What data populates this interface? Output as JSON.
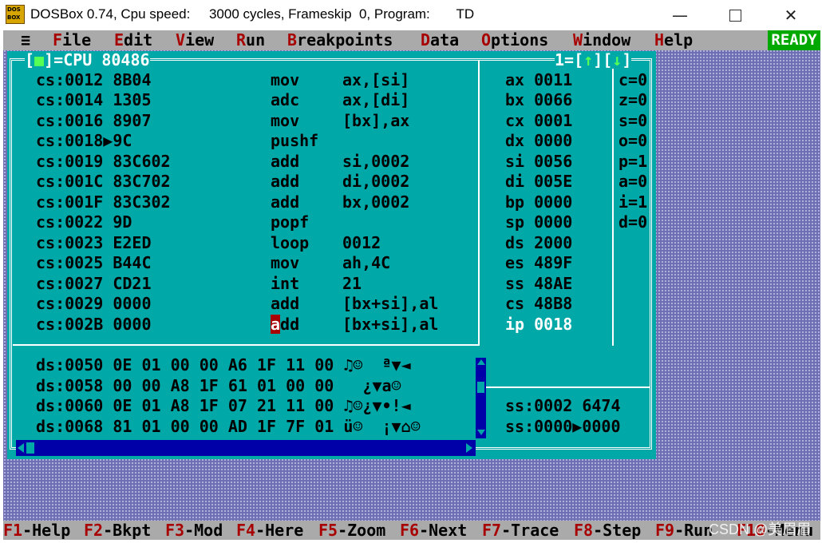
{
  "window": {
    "title": "DOSBox 0.74, Cpu speed:     3000 cycles, Frameskip  0, Program:       TD",
    "minimize": "—",
    "close": "✕"
  },
  "menu": {
    "system": "≡",
    "items": [
      {
        "hk": "F",
        "rest": "ile"
      },
      {
        "hk": "E",
        "rest": "dit"
      },
      {
        "hk": "V",
        "rest": "iew"
      },
      {
        "hk": "R",
        "rest": "un"
      },
      {
        "hk": "B",
        "rest": "reakpoints"
      },
      {
        "hk": "D",
        "rest": "ata"
      },
      {
        "hk": "O",
        "rest": "ptions"
      },
      {
        "hk": "W",
        "rest": "indow"
      },
      {
        "hk": "H",
        "rest": "elp"
      }
    ],
    "status": "READY"
  },
  "cpu": {
    "title": "CPU 80486",
    "window_number": "1",
    "close_box": "[■]",
    "scroll_up": "[↑]",
    "scroll_down": "[↓]",
    "code": [
      {
        "addr": "cs:0012",
        "mark": " ",
        "bytes": "8B04",
        "mnemonic": "mov",
        "operands": "ax,[si]"
      },
      {
        "addr": "cs:0014",
        "mark": " ",
        "bytes": "1305",
        "mnemonic": "adc",
        "operands": "ax,[di]"
      },
      {
        "addr": "cs:0016",
        "mark": " ",
        "bytes": "8907",
        "mnemonic": "mov",
        "operands": "[bx],ax"
      },
      {
        "addr": "cs:0018",
        "mark": "▶",
        "bytes": "9C",
        "mnemonic": "pushf",
        "operands": ""
      },
      {
        "addr": "cs:0019",
        "mark": " ",
        "bytes": "83C602",
        "mnemonic": "add",
        "operands": "si,0002"
      },
      {
        "addr": "cs:001C",
        "mark": " ",
        "bytes": "83C702",
        "mnemonic": "add",
        "operands": "di,0002"
      },
      {
        "addr": "cs:001F",
        "mark": " ",
        "bytes": "83C302",
        "mnemonic": "add",
        "operands": "bx,0002"
      },
      {
        "addr": "cs:0022",
        "mark": " ",
        "bytes": "9D",
        "mnemonic": "popf",
        "operands": ""
      },
      {
        "addr": "cs:0023",
        "mark": " ",
        "bytes": "E2ED",
        "mnemonic": "loop",
        "operands": "0012"
      },
      {
        "addr": "cs:0025",
        "mark": " ",
        "bytes": "B44C",
        "mnemonic": "mov",
        "operands": "ah,4C"
      },
      {
        "addr": "cs:0027",
        "mark": " ",
        "bytes": "CD21",
        "mnemonic": "int",
        "operands": "21"
      },
      {
        "addr": "cs:0029",
        "mark": " ",
        "bytes": "0000",
        "mnemonic": "add",
        "operands": "[bx+si],al"
      },
      {
        "addr": "cs:002B",
        "mark": " ",
        "bytes": "0000",
        "mnemonic": "add",
        "operands": "[bx+si],al"
      }
    ],
    "cursor_char": "a",
    "cursor_rest": "dd",
    "registers": [
      {
        "name": "ax",
        "value": "0011"
      },
      {
        "name": "bx",
        "value": "0066"
      },
      {
        "name": "cx",
        "value": "0001"
      },
      {
        "name": "dx",
        "value": "0000"
      },
      {
        "name": "si",
        "value": "0056"
      },
      {
        "name": "di",
        "value": "005E"
      },
      {
        "name": "bp",
        "value": "0000"
      },
      {
        "name": "sp",
        "value": "0000"
      },
      {
        "name": "ds",
        "value": "2000"
      },
      {
        "name": "es",
        "value": "489F"
      },
      {
        "name": "ss",
        "value": "48AE"
      },
      {
        "name": "cs",
        "value": "48B8"
      },
      {
        "name": "ip",
        "value": "0018"
      }
    ],
    "flags": [
      "c=0",
      "z=0",
      "s=0",
      "o=0",
      "p=1",
      "a=0",
      "i=1",
      "d=0"
    ],
    "dump": [
      {
        "addr": "ds:0050",
        "bytes": "0E 01 00 00 A6 1F 11 00",
        "ascii": "♫☺  ª▼◄ "
      },
      {
        "addr": "ds:0058",
        "bytes": "00 00 A8 1F 61 01 00 00",
        "ascii": "  ¿▼a☺  "
      },
      {
        "addr": "ds:0060",
        "bytes": "0E 01 A8 1F 07 21 11 00",
        "ascii": "♫☺¿▼•!◄ "
      },
      {
        "addr": "ds:0068",
        "bytes": "81 01 00 00 AD 1F 7F 01",
        "ascii": "ü☺  ¡▼⌂☺"
      }
    ],
    "stack": [
      {
        "addr": "ss:0002",
        "mark": " ",
        "value": "6474"
      },
      {
        "addr": "ss:0000",
        "mark": "▶",
        "value": "0000"
      }
    ]
  },
  "fkeys": [
    {
      "key": "F1",
      "label": "-Help"
    },
    {
      "key": "F2",
      "label": "-Bkpt"
    },
    {
      "key": "F3",
      "label": "-Mod"
    },
    {
      "key": "F4",
      "label": "-Here"
    },
    {
      "key": "F5",
      "label": "-Zoom"
    },
    {
      "key": "F6",
      "label": "-Next"
    },
    {
      "key": "F7",
      "label": "-Trace"
    },
    {
      "key": "F8",
      "label": "-Step"
    },
    {
      "key": "F9",
      "label": "-Run"
    },
    {
      "key": "F10",
      "label": "-Menu"
    }
  ],
  "watermark": "CSDN @美眉眉",
  "colors": {
    "cyan": "#00a8a8",
    "menu_gray": "#aaaaaa",
    "hotkey_red": "#a80000",
    "ready_green": "#00a800",
    "desktop_blue": "#6f6fb3"
  }
}
